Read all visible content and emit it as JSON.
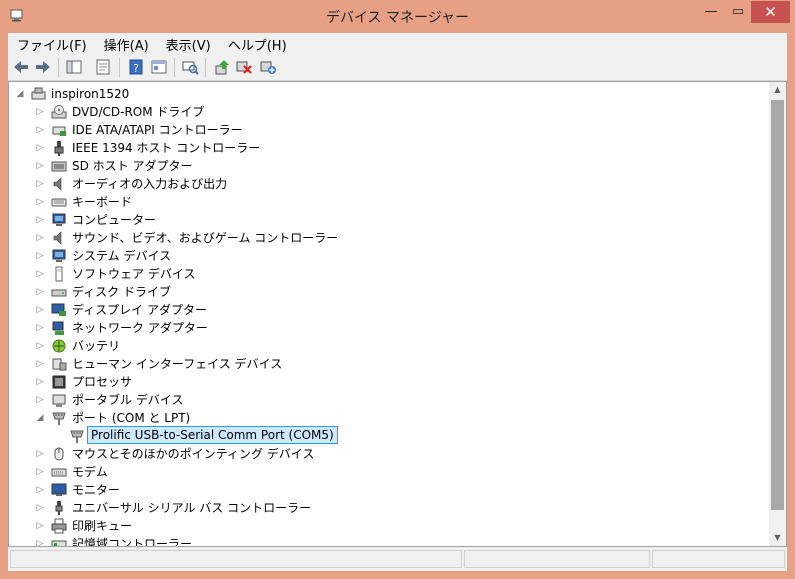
{
  "window": {
    "title": "デバイス マネージャー",
    "minimize": "—",
    "maximize": "▭",
    "close": "✕"
  },
  "menu": [
    "ファイル(F)",
    "操作(A)",
    "表示(V)",
    "ヘルプ(H)"
  ],
  "tree": {
    "root": "inspiron1520",
    "items": [
      {
        "label": "DVD/CD-ROM ドライブ",
        "icon": "optical-drive-icon",
        "expanded": false
      },
      {
        "label": "IDE ATA/ATAPI コントローラー",
        "icon": "ide-controller-icon",
        "expanded": false
      },
      {
        "label": "IEEE 1394 ホスト コントローラー",
        "icon": "firewire-icon",
        "expanded": false
      },
      {
        "label": "SD ホスト アダプター",
        "icon": "sd-host-icon",
        "expanded": false
      },
      {
        "label": "オーディオの入力および出力",
        "icon": "speaker-icon",
        "expanded": false
      },
      {
        "label": "キーボード",
        "icon": "keyboard-icon",
        "expanded": false
      },
      {
        "label": "コンピューター",
        "icon": "computer-icon",
        "expanded": false
      },
      {
        "label": "サウンド、ビデオ、およびゲーム コントローラー",
        "icon": "speaker-icon",
        "expanded": false
      },
      {
        "label": "システム デバイス",
        "icon": "computer-icon",
        "expanded": false
      },
      {
        "label": "ソフトウェア デバイス",
        "icon": "software-device-icon",
        "expanded": false
      },
      {
        "label": "ディスク ドライブ",
        "icon": "disk-drive-icon",
        "expanded": false
      },
      {
        "label": "ディスプレイ アダプター",
        "icon": "display-adapter-icon",
        "expanded": false
      },
      {
        "label": "ネットワーク アダプター",
        "icon": "network-icon",
        "expanded": false
      },
      {
        "label": "バッテリ",
        "icon": "battery-icon",
        "expanded": false
      },
      {
        "label": "ヒューマン インターフェイス デバイス",
        "icon": "hid-icon",
        "expanded": false
      },
      {
        "label": "プロセッサ",
        "icon": "processor-icon",
        "expanded": false
      },
      {
        "label": "ポータブル デバイス",
        "icon": "portable-device-icon",
        "expanded": false
      },
      {
        "label": "ポート (COM と LPT)",
        "icon": "port-icon",
        "expanded": true,
        "children": [
          {
            "label": "Prolific USB-to-Serial Comm Port (COM5)",
            "icon": "port-icon",
            "selected": true
          }
        ]
      },
      {
        "label": "マウスとそのほかのポインティング デバイス",
        "icon": "mouse-icon",
        "expanded": false
      },
      {
        "label": "モデム",
        "icon": "modem-icon",
        "expanded": false
      },
      {
        "label": "モニター",
        "icon": "monitor-icon",
        "expanded": false
      },
      {
        "label": "ユニバーサル シリアル バス コントローラー",
        "icon": "usb-icon",
        "expanded": false
      },
      {
        "label": "印刷キュー",
        "icon": "printer-icon",
        "expanded": false
      },
      {
        "label": "記憶域コントローラー",
        "icon": "storage-controller-icon",
        "expanded": false
      }
    ]
  },
  "toolbar": [
    "back-icon",
    "forward-icon",
    "tree-view-icon",
    "properties-icon",
    "help-icon",
    "view-icon",
    "scan-hardware-icon",
    "update-driver-icon",
    "uninstall-icon",
    "add-hardware-icon"
  ]
}
